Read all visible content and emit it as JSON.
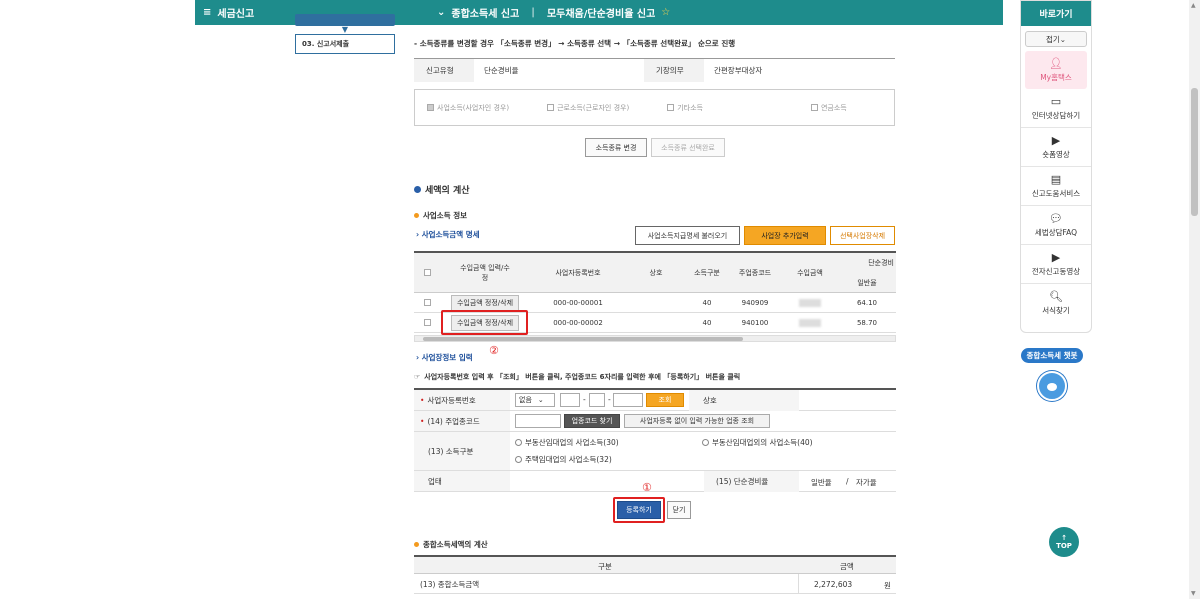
{
  "topbar": {
    "menu_icon": "hamburger-icon",
    "menu_label": "세금신고",
    "crumbs": [
      "종합소득세 신고",
      "모두채움/단순경비율 신고"
    ]
  },
  "leftnav": {
    "item": "03. 신고서제출"
  },
  "notice": "- 소득종류를 변경할 경우 「소득종류 변경」 → 소득종류 선택 → 「소득종류 선택완료」 순으로 진행",
  "info": {
    "type_label": "신고유형",
    "type_value": "단순경비율",
    "book_label": "기장의무",
    "book_value": "간편장부대상자"
  },
  "income_types": [
    "사업소득(사업자인 경우)",
    "근로소득(근로자인 경우)",
    "기타소득",
    "연금소득"
  ],
  "buttons": {
    "change": "소득종류 변경",
    "complete": "소득종류 선택완료"
  },
  "tax_calc_title": "세액의 계산",
  "biz_info_title": "사업소득 정보",
  "biz_amount_link": "사업소득금액 명세",
  "biz_actions": {
    "load": "사업소득지급명세 불러오기",
    "add": "사업장 추가입력",
    "delete": "선택사업장삭제"
  },
  "table": {
    "headers": {
      "income": "수입금액 입력/수정",
      "reg_no": "사업자등록번호",
      "name": "상호",
      "kind": "소득구분",
      "code": "주업종코드",
      "revenue": "수입금액",
      "simple_rate": "단순경비",
      "general_rate": "일반율"
    },
    "rows": [
      {
        "btn": "수입금액 정정/삭제",
        "reg_no": "000-00-00001",
        "name": "",
        "kind": "40",
        "code": "940909",
        "rate": "64.10"
      },
      {
        "btn": "수입금액 정정/삭제",
        "reg_no": "000-00-00002",
        "name": "",
        "kind": "40",
        "code": "940100",
        "rate": "58.70"
      }
    ]
  },
  "marker2": "②",
  "marker1": "①",
  "biz_input_link": "사업장정보 입력",
  "instruction": "사업자등록번호 입력 후 「조회」 버튼을 클릭, 주업종코드 6자리를 입력한 후에 「등록하기」 버튼을 클릭",
  "form": {
    "reg_label": "사업자등록번호",
    "select_value": "없음",
    "lookup_btn": "조회",
    "name_label": "상호",
    "code_label": "(14) 주업종코드",
    "code_find_btn": "업종코드 찾기",
    "code_nobiz_btn": "사업자등록 없이 입력 가능한 업종 조회",
    "kind_label": "(13) 소득구분",
    "kind_options": [
      "부동산임대업의 사업소득(30)",
      "부동산임대업외의 사업소득(40)",
      "주택임대업의 사업소득(32)"
    ],
    "industry_label": "업태",
    "rate_label": "(15) 단순경비율",
    "rate_general": "일반율",
    "rate_slash": "/",
    "rate_self": "자가율"
  },
  "register_btn": "등록하기",
  "close_btn": "닫기",
  "summary": {
    "title": "종합소득세액의 계산",
    "col_name": "구분",
    "col_amount": "금액",
    "row_label": "(13) 종합소득금액",
    "row_value": "2,272,603",
    "row_unit": "원"
  },
  "rightpanel": {
    "title": "바로가기",
    "fold": "접기",
    "items": [
      {
        "label": "My홈택스",
        "icon": "person-icon"
      },
      {
        "label": "인터넷상담하기",
        "icon": "laptop-icon"
      },
      {
        "label": "숏폼영상",
        "icon": "play-icon"
      },
      {
        "label": "신고도움서비스",
        "icon": "book-icon"
      },
      {
        "label": "세법상담FAQ",
        "icon": "chat-icon"
      },
      {
        "label": "전자신고동영상",
        "icon": "video-icon"
      },
      {
        "label": "서식찾기",
        "icon": "search-icon"
      }
    ]
  },
  "chatbot": "종합소득세 챗봇",
  "top_btn": "TOP"
}
